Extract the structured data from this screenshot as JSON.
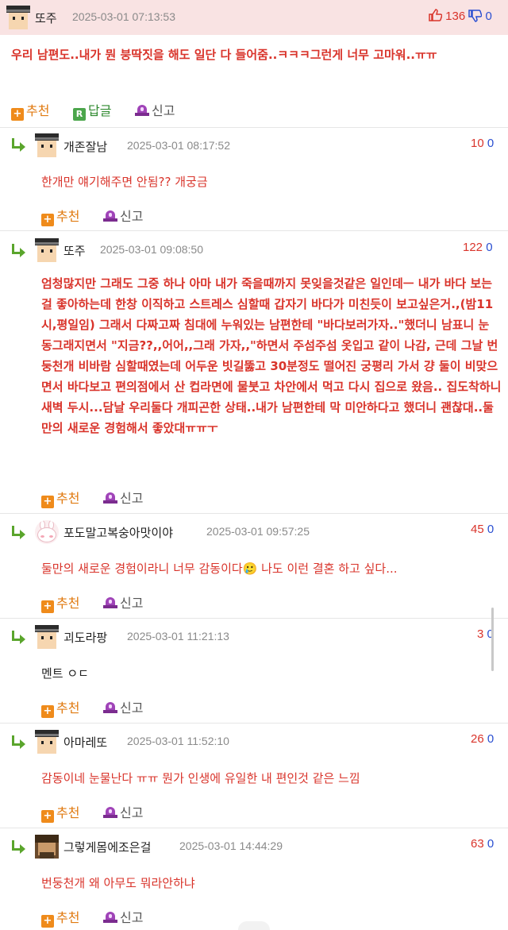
{
  "original_post": {
    "nick": "또주",
    "date": "2025-03-01 07:13:53",
    "up_count": "136",
    "down_count": "0",
    "text": "우리 남편도..내가 뭔 붕딱짓을 해도 일단 다 들어줌..ㅋㅋㅋ그런게 너무 고마워..ㅠㅠ",
    "actions": {
      "recommend": "추천",
      "reply": "답글",
      "report": "신고"
    }
  },
  "comments": [
    {
      "nick": "개존잘남",
      "date": "2025-03-01 08:17:52",
      "up": "10",
      "down": "0",
      "text": "한개만 얘기해주면 안됨?? 개궁금",
      "bold": false,
      "color": "red"
    },
    {
      "nick": "또주",
      "date": "2025-03-01 09:08:50",
      "up": "122",
      "down": "0",
      "text": "엄청많지만 그래도 그중 하나 아마 내가 죽을때까지 못잊을것같은 일인데ㅡ 내가 바다 보는걸 좋아하는데 한창 이직하고 스트레스 심할때 갑자기 바다가 미친듯이 보고싶은거.,(밤11시,평일임) 그래서 다짜고짜 침대에 누워있는 남편한테 \"바다보러가자..\"했더니 남표니 눈 동그래지면서 \"지금??,,어어,,그래 가자,,\"하면서 주섬주섬 옷입고 같이 나감, 근데 그날 번둥천개 비바람 심할때였는데 어두운 빗길뚫고 30분정도 떨어진 궁평리 가서 걍 둘이 비맞으면서 바다보고 편의점에서 산 컵라면에 물붓고 차안에서 먹고 다시 집으로 왔음.. 집도착하니 새벽 두시...담날 우리둘다 개피곤한 상태..내가 남편한테 막 미안하다고 했더니 괜찮대..둘만의 새로운 경험해서 좋았대ㅠㅠㅜ",
      "bold": true,
      "color": "red"
    },
    {
      "nick": "포도말고복숭아맛이야",
      "date": "2025-03-01 09:57:25",
      "up": "45",
      "down": "0",
      "text": "둘만의 새로운 경험이라니 너무 감동이다🥲 나도 이런 결혼 하고 싶다...",
      "bold": false,
      "color": "red"
    },
    {
      "nick": "괴도라팡",
      "date": "2025-03-01 11:21:13",
      "up": "3",
      "down": "0",
      "text": "멘트 ㅇㄷ",
      "bold": false,
      "color": "dark"
    },
    {
      "nick": "아마레또",
      "date": "2025-03-01 11:52:10",
      "up": "26",
      "down": "0",
      "text": "감동이네 눈물난다 ㅠㅠ 뭔가 인생에 유일한 내 편인것 같은 느낌",
      "bold": false,
      "color": "red"
    },
    {
      "nick": "그렇게몸에조은걸",
      "date": "2025-03-01 14:44:29",
      "up": "63",
      "down": "0",
      "text": "번둥천개 왜 아무도 뭐라안하냐",
      "bold": false,
      "color": "red"
    }
  ],
  "comment_actions": {
    "recommend": "추천",
    "report": "신고"
  },
  "icons": {
    "up": "thumbs-up-icon",
    "down": "thumbs-down-icon",
    "reply_arrow": "reply-arrow-icon",
    "recommend": "plus-icon",
    "reply": "reply-r-icon",
    "report": "siren-icon"
  },
  "colors": {
    "accent_red": "#d9342b",
    "down_blue": "#2a4fd1",
    "reply_green": "#5aa52c",
    "recommend_orange": "#ef8b1b",
    "op_header_bg": "#f9e3e3"
  }
}
